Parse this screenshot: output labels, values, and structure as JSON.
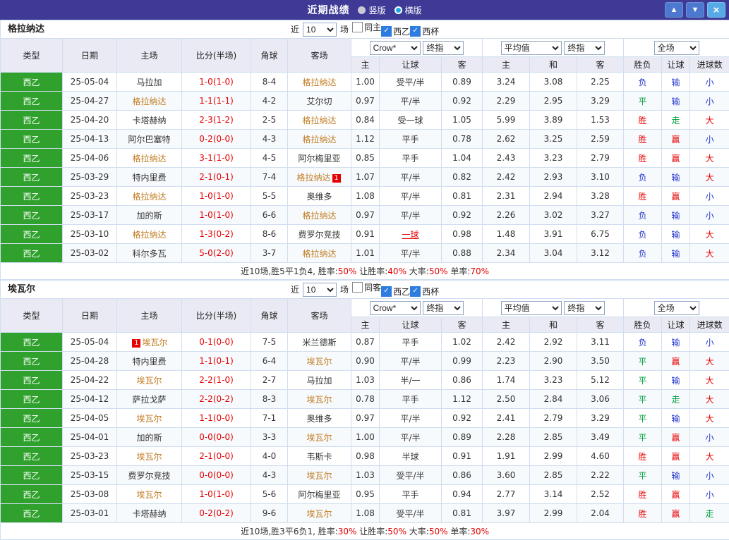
{
  "titlebar": {
    "title": "近期战绩",
    "radios": [
      {
        "label": "竖版",
        "selected": false
      },
      {
        "label": "横版",
        "selected": true
      }
    ],
    "buttons": {
      "up": "▲",
      "down": "▼",
      "close": "×"
    }
  },
  "colors": {
    "titlebar_bg": "#3e3a96",
    "league_green": "#2fa12c",
    "win_red": "#e60000",
    "lose_blue": "#2336cc",
    "draw_green": "#00a03c",
    "focus_team_orange": "#c0791c",
    "outcome_classes": {
      "胜": "c-red",
      "平": "c-green",
      "负": "c-blue",
      "赢": "c-red",
      "输": "c-blue",
      "走": "c-green",
      "大": "c-red",
      "小": "c-blue"
    }
  },
  "columns": [
    "类型",
    "日期",
    "主场",
    "比分(半场)",
    "角球",
    "客场"
  ],
  "sub_columns": [
    "主",
    "让球",
    "客",
    "主",
    "和",
    "客",
    "胜负",
    "让球",
    "进球数"
  ],
  "sections": [
    {
      "team": "格拉纳达",
      "filters": {
        "prefix": "近",
        "count": "10",
        "suffix": "场",
        "checks": [
          {
            "label": "同主",
            "checked": false
          },
          {
            "label": "西乙",
            "checked": true
          },
          {
            "label": "西杯",
            "checked": true
          }
        ]
      },
      "selects": {
        "company": "Crow*",
        "company_stage": "终指",
        "avg": "平均值",
        "avg_stage": "终指",
        "scope": "全场"
      },
      "rows": [
        {
          "type": "西乙",
          "date": "25-05-04",
          "home": "马拉加",
          "score": "1-0(1-0)",
          "corner": "8-4",
          "away": "格拉纳达",
          "o1": "1.00",
          "hc": "受平/半",
          "o2": "0.89",
          "a1": "3.24",
          "a2": "3.08",
          "a3": "2.25",
          "res": "负",
          "lt": "输",
          "gl": "小"
        },
        {
          "type": "西乙",
          "date": "25-04-27",
          "home": "格拉纳达",
          "score": "1-1(1-1)",
          "corner": "4-2",
          "away": "艾尔切",
          "o1": "0.97",
          "hc": "平/半",
          "o2": "0.92",
          "a1": "2.29",
          "a2": "2.95",
          "a3": "3.29",
          "res": "平",
          "lt": "输",
          "gl": "小"
        },
        {
          "type": "西乙",
          "date": "25-04-20",
          "home": "卡塔赫纳",
          "score": "2-3(1-2)",
          "corner": "2-5",
          "away": "格拉纳达",
          "o1": "0.84",
          "hc": "受一球",
          "o2": "1.05",
          "a1": "5.99",
          "a2": "3.89",
          "a3": "1.53",
          "res": "胜",
          "lt": "走",
          "gl": "大"
        },
        {
          "type": "西乙",
          "date": "25-04-13",
          "home": "阿尔巴塞特",
          "score": "0-2(0-0)",
          "corner": "4-3",
          "away": "格拉纳达",
          "o1": "1.12",
          "hc": "平手",
          "o2": "0.78",
          "a1": "2.62",
          "a2": "3.25",
          "a3": "2.59",
          "res": "胜",
          "lt": "赢",
          "gl": "小"
        },
        {
          "type": "西乙",
          "date": "25-04-06",
          "home": "格拉纳达",
          "score": "3-1(1-0)",
          "corner": "4-5",
          "away": "阿尔梅里亚",
          "o1": "0.85",
          "hc": "平手",
          "o2": "1.04",
          "a1": "2.43",
          "a2": "3.23",
          "a3": "2.79",
          "res": "胜",
          "lt": "赢",
          "gl": "大"
        },
        {
          "type": "西乙",
          "date": "25-03-29",
          "home": "特内里费",
          "score": "2-1(0-1)",
          "corner": "7-4",
          "away": "格拉纳达",
          "away_badge": {
            "text": "1",
            "pos": "right"
          },
          "o1": "1.07",
          "hc": "平/半",
          "o2": "0.82",
          "a1": "2.42",
          "a2": "2.93",
          "a3": "3.10",
          "res": "负",
          "lt": "输",
          "gl": "大"
        },
        {
          "type": "西乙",
          "date": "25-03-23",
          "home": "格拉纳达",
          "score": "1-0(1-0)",
          "corner": "5-5",
          "away": "奥维多",
          "o1": "1.08",
          "hc": "平/半",
          "o2": "0.81",
          "a1": "2.31",
          "a2": "2.94",
          "a3": "3.28",
          "res": "胜",
          "lt": "赢",
          "gl": "小"
        },
        {
          "type": "西乙",
          "date": "25-03-17",
          "home": "加的斯",
          "score": "1-0(1-0)",
          "corner": "6-6",
          "away": "格拉纳达",
          "o1": "0.97",
          "hc": "平/半",
          "o2": "0.92",
          "a1": "2.26",
          "a2": "3.02",
          "a3": "3.27",
          "res": "负",
          "lt": "输",
          "gl": "小"
        },
        {
          "type": "西乙",
          "date": "25-03-10",
          "home": "格拉纳达",
          "score": "1-3(0-2)",
          "corner": "8-6",
          "away": "费罗尔竞技",
          "o1": "0.91",
          "hc": "一球",
          "hot": true,
          "o2": "0.98",
          "a1": "1.48",
          "a2": "3.91",
          "a3": "6.75",
          "res": "负",
          "lt": "输",
          "gl": "大"
        },
        {
          "type": "西乙",
          "date": "25-03-02",
          "home": "科尔多瓦",
          "score": "5-0(2-0)",
          "corner": "3-7",
          "away": "格拉纳达",
          "o1": "1.01",
          "hc": "平/半",
          "o2": "0.88",
          "a1": "2.34",
          "a2": "3.04",
          "a3": "3.12",
          "res": "负",
          "lt": "输",
          "gl": "大"
        }
      ],
      "summary": [
        {
          "text": "近10场,胜5平1负4, 胜率:",
          "red": false
        },
        {
          "text": "50%",
          "red": true
        },
        {
          "text": " 让胜率:",
          "red": false
        },
        {
          "text": "40%",
          "red": true
        },
        {
          "text": " 大率:",
          "red": false
        },
        {
          "text": "50%",
          "red": true
        },
        {
          "text": " 单率:",
          "red": false
        },
        {
          "text": "70%",
          "red": true
        }
      ]
    },
    {
      "team": "埃瓦尔",
      "filters": {
        "prefix": "近",
        "count": "10",
        "suffix": "场",
        "checks": [
          {
            "label": "同客",
            "checked": false
          },
          {
            "label": "西乙",
            "checked": true
          },
          {
            "label": "西杯",
            "checked": true
          }
        ]
      },
      "selects": {
        "company": "Crow*",
        "company_stage": "终指",
        "avg": "平均值",
        "avg_stage": "终指",
        "scope": "全场"
      },
      "rows": [
        {
          "type": "西乙",
          "date": "25-05-04",
          "home": "埃瓦尔",
          "home_badge": {
            "text": "1",
            "pos": "left"
          },
          "score": "0-1(0-0)",
          "corner": "7-5",
          "away": "米兰德斯",
          "o1": "0.87",
          "hc": "平手",
          "o2": "1.02",
          "a1": "2.42",
          "a2": "2.92",
          "a3": "3.11",
          "res": "负",
          "lt": "输",
          "gl": "小"
        },
        {
          "type": "西乙",
          "date": "25-04-28",
          "home": "特内里费",
          "score": "1-1(0-1)",
          "corner": "6-4",
          "away": "埃瓦尔",
          "o1": "0.90",
          "hc": "平/半",
          "o2": "0.99",
          "a1": "2.23",
          "a2": "2.90",
          "a3": "3.50",
          "res": "平",
          "lt": "赢",
          "gl": "大"
        },
        {
          "type": "西乙",
          "date": "25-04-22",
          "home": "埃瓦尔",
          "score": "2-2(1-0)",
          "corner": "2-7",
          "away": "马拉加",
          "o1": "1.03",
          "hc": "半/一",
          "o2": "0.86",
          "a1": "1.74",
          "a2": "3.23",
          "a3": "5.12",
          "res": "平",
          "lt": "输",
          "gl": "大"
        },
        {
          "type": "西乙",
          "date": "25-04-12",
          "home": "萨拉戈萨",
          "score": "2-2(0-2)",
          "corner": "8-3",
          "away": "埃瓦尔",
          "o1": "0.78",
          "hc": "平手",
          "o2": "1.12",
          "a1": "2.50",
          "a2": "2.84",
          "a3": "3.06",
          "res": "平",
          "lt": "走",
          "gl": "大"
        },
        {
          "type": "西乙",
          "date": "25-04-05",
          "home": "埃瓦尔",
          "score": "1-1(0-0)",
          "corner": "7-1",
          "away": "奥维多",
          "o1": "0.97",
          "hc": "平/半",
          "o2": "0.92",
          "a1": "2.41",
          "a2": "2.79",
          "a3": "3.29",
          "res": "平",
          "lt": "输",
          "gl": "大"
        },
        {
          "type": "西乙",
          "date": "25-04-01",
          "home": "加的斯",
          "score": "0-0(0-0)",
          "corner": "3-3",
          "away": "埃瓦尔",
          "o1": "1.00",
          "hc": "平/半",
          "o2": "0.89",
          "a1": "2.28",
          "a2": "2.85",
          "a3": "3.49",
          "res": "平",
          "lt": "赢",
          "gl": "小"
        },
        {
          "type": "西乙",
          "date": "25-03-23",
          "home": "埃瓦尔",
          "score": "2-1(0-0)",
          "corner": "4-0",
          "away": "韦斯卡",
          "o1": "0.98",
          "hc": "半球",
          "o2": "0.91",
          "a1": "1.91",
          "a2": "2.99",
          "a3": "4.60",
          "res": "胜",
          "lt": "赢",
          "gl": "大"
        },
        {
          "type": "西乙",
          "date": "25-03-15",
          "home": "费罗尔竞技",
          "score": "0-0(0-0)",
          "corner": "4-3",
          "away": "埃瓦尔",
          "o1": "1.03",
          "hc": "受平/半",
          "o2": "0.86",
          "a1": "3.60",
          "a2": "2.85",
          "a3": "2.22",
          "res": "平",
          "lt": "输",
          "gl": "小"
        },
        {
          "type": "西乙",
          "date": "25-03-08",
          "home": "埃瓦尔",
          "score": "1-0(1-0)",
          "corner": "5-6",
          "away": "阿尔梅里亚",
          "o1": "0.95",
          "hc": "平手",
          "o2": "0.94",
          "a1": "2.77",
          "a2": "3.14",
          "a3": "2.52",
          "res": "胜",
          "lt": "赢",
          "gl": "小"
        },
        {
          "type": "西乙",
          "date": "25-03-01",
          "home": "卡塔赫纳",
          "score": "0-2(0-2)",
          "corner": "9-6",
          "away": "埃瓦尔",
          "o1": "1.08",
          "hc": "受平/半",
          "o2": "0.81",
          "a1": "3.97",
          "a2": "2.99",
          "a3": "2.04",
          "res": "胜",
          "lt": "赢",
          "gl": "走"
        }
      ],
      "summary": [
        {
          "text": "近10场,胜3平6负1, 胜率:",
          "red": false
        },
        {
          "text": "30%",
          "red": true
        },
        {
          "text": " 让胜率:",
          "red": false
        },
        {
          "text": "50%",
          "red": true
        },
        {
          "text": " 大率:",
          "red": false
        },
        {
          "text": "50%",
          "red": true
        },
        {
          "text": " 单率:",
          "red": false
        },
        {
          "text": "30%",
          "red": true
        }
      ]
    }
  ]
}
